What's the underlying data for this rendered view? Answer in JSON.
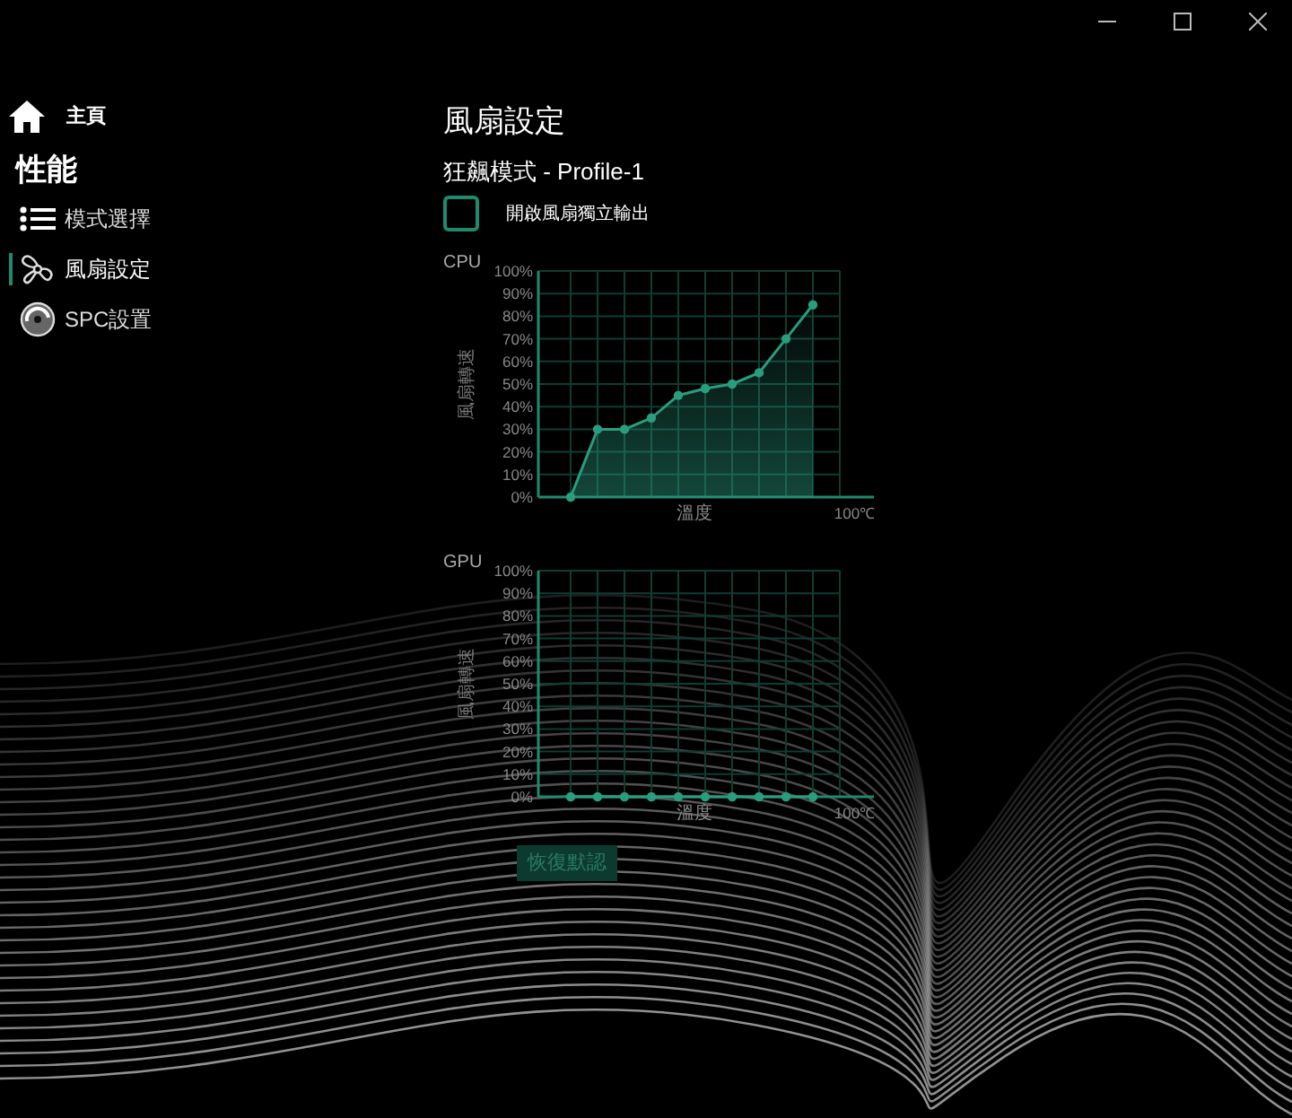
{
  "sidebar": {
    "home": {
      "label": "主頁"
    },
    "section": "性能",
    "items": [
      {
        "label": "模式選擇",
        "selected": false
      },
      {
        "label": "風扇設定",
        "selected": true
      },
      {
        "label": "SPC設置",
        "selected": false
      }
    ]
  },
  "page": {
    "title": "風扇設定",
    "profile": "狂飆模式 - Profile-1",
    "independent_output": {
      "label": "開啟風扇獨立輸出",
      "checked": false
    }
  },
  "charts": [
    {
      "x_axis_end": "100℃",
      "chart_data": {
        "type": "area",
        "title": "CPU",
        "xlabel": "溫度",
        "ylabel": "風扇轉速",
        "grid": true,
        "yticks": [
          {
            "value": 0,
            "label": "0%"
          },
          {
            "value": 10,
            "label": "10%"
          },
          {
            "value": 20,
            "label": "20%"
          },
          {
            "value": 30,
            "label": "30%"
          },
          {
            "value": 40,
            "label": "40%"
          },
          {
            "value": 50,
            "label": "50%"
          },
          {
            "value": 60,
            "label": "60%"
          },
          {
            "value": 70,
            "label": "70%"
          },
          {
            "value": 80,
            "label": "80%"
          },
          {
            "value": 90,
            "label": "90%"
          },
          {
            "value": 100,
            "label": "100%"
          }
        ],
        "ylim": [
          0,
          100
        ],
        "series": [
          {
            "color": "#2a9d7f",
            "marker": "circle",
            "values": [
              0,
              30,
              30,
              35,
              45,
              48,
              50,
              55,
              70,
              85
            ]
          }
        ]
      }
    },
    {
      "x_axis_end": "100℃",
      "chart_data": {
        "type": "line",
        "title": "GPU",
        "xlabel": "溫度",
        "ylabel": "風扇轉速",
        "grid": true,
        "yticks": [
          {
            "value": 0,
            "label": "0%"
          },
          {
            "value": 10,
            "label": "10%"
          },
          {
            "value": 20,
            "label": "20%"
          },
          {
            "value": 30,
            "label": "30%"
          },
          {
            "value": 40,
            "label": "40%"
          },
          {
            "value": 50,
            "label": "50%"
          },
          {
            "value": 60,
            "label": "60%"
          },
          {
            "value": 70,
            "label": "70%"
          },
          {
            "value": 80,
            "label": "80%"
          },
          {
            "value": 90,
            "label": "90%"
          },
          {
            "value": 100,
            "label": "100%"
          }
        ],
        "ylim": [
          0,
          100
        ],
        "series": [
          {
            "color": "#2a9d7f",
            "marker": "circle",
            "values": [
              0,
              0,
              0,
              0,
              0,
              0,
              0,
              0,
              0,
              0
            ]
          }
        ]
      }
    }
  ],
  "reset_button": {
    "label": "恢復默認",
    "disabled": true
  }
}
